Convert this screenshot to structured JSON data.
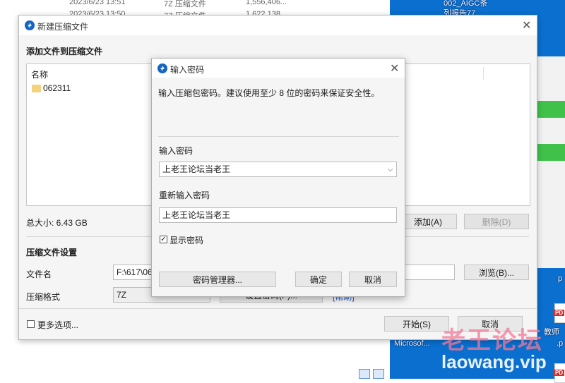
{
  "background": {
    "rows": [
      {
        "date": "2023/6/23 13:51",
        "type": "7Z 压缩文件",
        "size": "1,556,406..."
      },
      {
        "date": "2023/6/23 13:50",
        "type": "7Z 压缩文件",
        "size": "1,622,138..."
      }
    ],
    "desktop_labels": [
      "002_AIGC条",
      "列报告77...",
      "Microsof...",
      "教师",
      ".p",
      "p"
    ],
    "desktop_colors": {
      "desktop": "#0a6fcf",
      "bar": "#3fc14a"
    }
  },
  "main_dialog": {
    "title": "新建压缩文件",
    "add_section": "添加文件到压缩文件",
    "list_header": "名称",
    "files": [
      "062311"
    ],
    "total_size": "总大小: 6.43 GB",
    "add_button": "添加(A)",
    "delete_button": "删除(D)",
    "settings_section": "压缩文件设置",
    "filename_label": "文件名",
    "filename_value": "F:\\617\\06",
    "browse_button": "浏览(B)...",
    "format_label": "压缩格式",
    "format_value": "7Z",
    "set_password_button": "设置密码(P)...",
    "help_link": "[帮助]",
    "more_options": "更多选项...",
    "start_button": "开始(S)",
    "cancel_button": "取消"
  },
  "password_dialog": {
    "title": "输入密码",
    "description": "输入压缩包密码。建议使用至少 8 位的密码来保证安全性。",
    "enter_label": "输入密码",
    "enter_value": "上老王论坛当老王",
    "reenter_label": "重新输入密码",
    "reenter_value": "上老王论坛当老王",
    "show_password": "显示密码",
    "show_password_checked": true,
    "manager_button": "密码管理器...",
    "ok_button": "确定",
    "cancel_button": "取消"
  },
  "watermark": {
    "line1": "老王论坛",
    "line2": "laowang.vip"
  }
}
